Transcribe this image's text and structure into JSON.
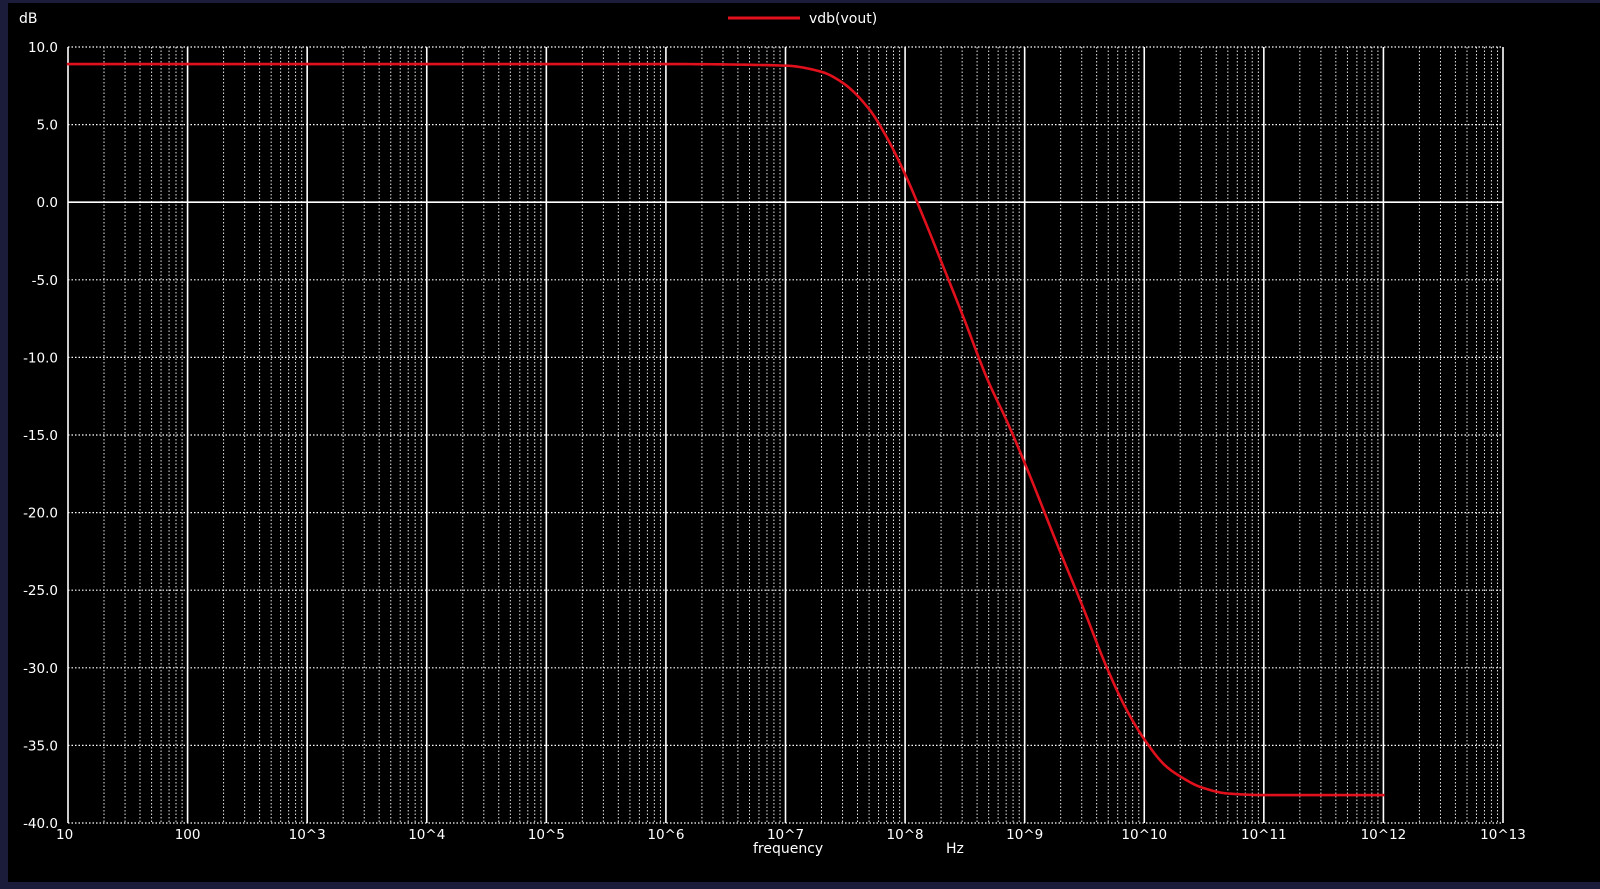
{
  "colors": {
    "frame_background": "#1b1b3a",
    "plot_background": "#000000",
    "grid": "#ffffff",
    "text": "#ffffff",
    "trace": "#e0101c"
  },
  "chart_data": {
    "type": "line",
    "title": "",
    "xlabel": "frequency",
    "xunit": "Hz",
    "ylabel": "dB",
    "xscale": "log",
    "xlim": [
      10,
      10000000000000.0
    ],
    "ylim": [
      -40,
      10
    ],
    "grid": "dotted major and minor gridlines; solid lines at decades and at 0 dB",
    "legend": "top-center",
    "x_tick_labels": [
      "10",
      "100",
      "10^3",
      "10^4",
      "10^5",
      "10^6",
      "10^7",
      "10^8",
      "10^9",
      "10^10",
      "10^11",
      "10^12",
      "10^13"
    ],
    "y_tick_labels": [
      "10.0",
      "5.0",
      "0.0",
      "-5.0",
      "-10.0",
      "-15.0",
      "-20.0",
      "-25.0",
      "-30.0",
      "-35.0",
      "-40.0"
    ],
    "series": [
      {
        "name": "vdb(vout)",
        "color": "#e0101c",
        "x": [
          10,
          100,
          1000,
          10000,
          100000,
          1000000,
          10000000,
          20000000,
          30000000,
          50000000,
          70000000,
          100000000,
          150000000,
          200000000,
          300000000,
          500000000,
          700000000,
          1000000000,
          2000000000,
          3000000000,
          5000000000,
          7000000000,
          10000000000,
          15000000000,
          20000000000,
          30000000000,
          50000000000,
          100000000000,
          1000000000000
        ],
        "y": [
          8.9,
          8.9,
          8.9,
          8.9,
          8.9,
          8.9,
          8.8,
          8.4,
          7.7,
          6.0,
          4.2,
          1.8,
          -1.4,
          -3.8,
          -7.2,
          -11.6,
          -14.0,
          -16.8,
          -22.6,
          -25.9,
          -30.2,
          -32.6,
          -34.6,
          -36.3,
          -37.0,
          -37.7,
          -38.1,
          -38.2,
          -38.2
        ]
      }
    ]
  }
}
